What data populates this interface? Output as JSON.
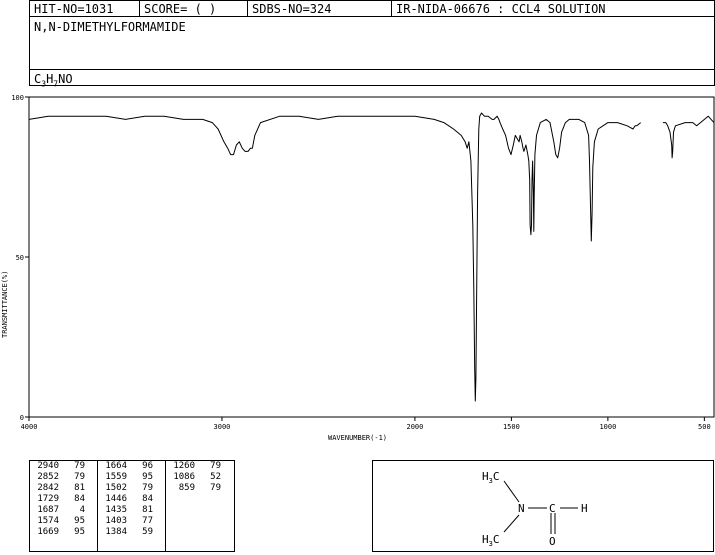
{
  "header": {
    "hit_no": "HIT-NO=1031",
    "score": "SCORE=  (   )",
    "sdbs_no": "SDBS-NO=324",
    "ir_nida": "IR-NIDA-06676 : CCL4 SOLUTION"
  },
  "compound": {
    "name": "N,N-DIMETHYLFORMAMIDE",
    "formula_parts": [
      "C",
      "3",
      "H",
      "7",
      "NO"
    ]
  },
  "chart_data": {
    "type": "line",
    "xlabel": "WAVENUMBER(-1)",
    "ylabel": "TRANSMITTANCE(%)",
    "xlim": [
      4000,
      450
    ],
    "ylim": [
      0,
      100
    ],
    "x_ticks": [
      4000,
      3000,
      2000,
      1500,
      1000,
      500
    ],
    "y_ticks": [
      0,
      50,
      100
    ],
    "grid": false,
    "series": [
      {
        "segments": [
          [
            [
              4000,
              93
            ],
            [
              3900,
              94
            ],
            [
              3800,
              94
            ],
            [
              3700,
              94
            ],
            [
              3600,
              94
            ],
            [
              3500,
              93
            ],
            [
              3400,
              94
            ],
            [
              3300,
              94
            ],
            [
              3200,
              93
            ],
            [
              3100,
              93
            ],
            [
              3050,
              92
            ],
            [
              3020,
              90
            ],
            [
              2990,
              86
            ],
            [
              2970,
              84
            ],
            [
              2955,
              82
            ],
            [
              2940,
              82
            ],
            [
              2925,
              85
            ],
            [
              2910,
              86
            ],
            [
              2895,
              84
            ],
            [
              2880,
              83
            ],
            [
              2865,
              83
            ],
            [
              2852,
              84
            ],
            [
              2842,
              84
            ],
            [
              2830,
              88
            ],
            [
              2800,
              92
            ],
            [
              2700,
              94
            ],
            [
              2600,
              94
            ],
            [
              2500,
              93
            ],
            [
              2400,
              94
            ],
            [
              2300,
              94
            ],
            [
              2200,
              94
            ],
            [
              2100,
              94
            ],
            [
              2000,
              94
            ],
            [
              1900,
              93
            ],
            [
              1850,
              92
            ],
            [
              1800,
              90
            ],
            [
              1760,
              88
            ],
            [
              1740,
              86
            ],
            [
              1729,
              84
            ],
            [
              1720,
              86
            ],
            [
              1710,
              80
            ],
            [
              1700,
              60
            ],
            [
              1695,
              40
            ],
            [
              1690,
              15
            ],
            [
              1687,
              5
            ],
            [
              1684,
              12
            ],
            [
              1680,
              40
            ],
            [
              1675,
              70
            ],
            [
              1669,
              90
            ],
            [
              1664,
              94
            ],
            [
              1655,
              95
            ],
            [
              1640,
              94
            ],
            [
              1620,
              94
            ],
            [
              1600,
              93
            ],
            [
              1590,
              93
            ],
            [
              1574,
              94
            ],
            [
              1565,
              93
            ],
            [
              1559,
              92
            ],
            [
              1545,
              90
            ],
            [
              1530,
              88
            ],
            [
              1515,
              84
            ],
            [
              1502,
              82
            ],
            [
              1490,
              85
            ],
            [
              1480,
              88
            ],
            [
              1470,
              87
            ],
            [
              1460,
              86
            ],
            [
              1455,
              88
            ],
            [
              1446,
              86
            ],
            [
              1440,
              84
            ],
            [
              1435,
              83
            ],
            [
              1425,
              85
            ],
            [
              1415,
              82
            ],
            [
              1410,
              80
            ],
            [
              1405,
              74
            ],
            [
              1403,
              60
            ],
            [
              1399,
              57
            ],
            [
              1396,
              60
            ],
            [
              1393,
              74
            ],
            [
              1390,
              80
            ],
            [
              1386,
              70
            ],
            [
              1384,
              58
            ],
            [
              1382,
              69
            ],
            [
              1378,
              82
            ],
            [
              1370,
              88
            ],
            [
              1350,
              92
            ],
            [
              1320,
              93
            ],
            [
              1300,
              92
            ],
            [
              1280,
              86
            ],
            [
              1270,
              82
            ],
            [
              1260,
              81
            ],
            [
              1250,
              84
            ],
            [
              1240,
              89
            ],
            [
              1220,
              92
            ],
            [
              1200,
              93
            ],
            [
              1150,
              93
            ],
            [
              1120,
              92
            ],
            [
              1100,
              88
            ],
            [
              1095,
              80
            ],
            [
              1090,
              66
            ],
            [
              1086,
              55
            ],
            [
              1082,
              64
            ],
            [
              1078,
              78
            ],
            [
              1070,
              86
            ],
            [
              1050,
              90
            ],
            [
              1000,
              92
            ],
            [
              950,
              92
            ],
            [
              900,
              91
            ],
            [
              870,
              90
            ],
            [
              859,
              91
            ],
            [
              850,
              91
            ],
            [
              830,
              92
            ]
          ],
          [
            [
              715,
              92
            ],
            [
              700,
              92
            ],
            [
              690,
              91
            ],
            [
              678,
              89
            ],
            [
              669,
              85
            ],
            [
              667,
              81
            ],
            [
              664,
              83
            ],
            [
              660,
              89
            ],
            [
              650,
              91
            ],
            [
              600,
              92
            ],
            [
              560,
              92
            ],
            [
              540,
              91
            ],
            [
              520,
              92
            ],
            [
              500,
              93
            ],
            [
              480,
              94
            ],
            [
              465,
              93
            ],
            [
              450,
              92
            ]
          ]
        ]
      }
    ],
    "peak_table": [
      {
        "wavenumber": 2940,
        "transmittance": 79
      },
      {
        "wavenumber": 2852,
        "transmittance": 79
      },
      {
        "wavenumber": 2842,
        "transmittance": 81
      },
      {
        "wavenumber": 1729,
        "transmittance": 84
      },
      {
        "wavenumber": 1687,
        "transmittance": 4
      },
      {
        "wavenumber": 1574,
        "transmittance": 95
      },
      {
        "wavenumber": 1669,
        "transmittance": 95
      },
      {
        "wavenumber": 1664,
        "transmittance": 96
      },
      {
        "wavenumber": 1559,
        "transmittance": 95
      },
      {
        "wavenumber": 1502,
        "transmittance": 79
      },
      {
        "wavenumber": 1446,
        "transmittance": 84
      },
      {
        "wavenumber": 1435,
        "transmittance": 81
      },
      {
        "wavenumber": 1403,
        "transmittance": 77
      },
      {
        "wavenumber": 1384,
        "transmittance": 59
      },
      {
        "wavenumber": 1260,
        "transmittance": 79
      },
      {
        "wavenumber": 1086,
        "transmittance": 52
      },
      {
        "wavenumber": 859,
        "transmittance": 79
      }
    ]
  },
  "structure": {
    "ch3_top": [
      "H",
      "3",
      "C"
    ],
    "ch3_bottom": [
      "H",
      "3",
      "C"
    ],
    "n": "N",
    "c": "C",
    "h": "H",
    "o": "O"
  }
}
